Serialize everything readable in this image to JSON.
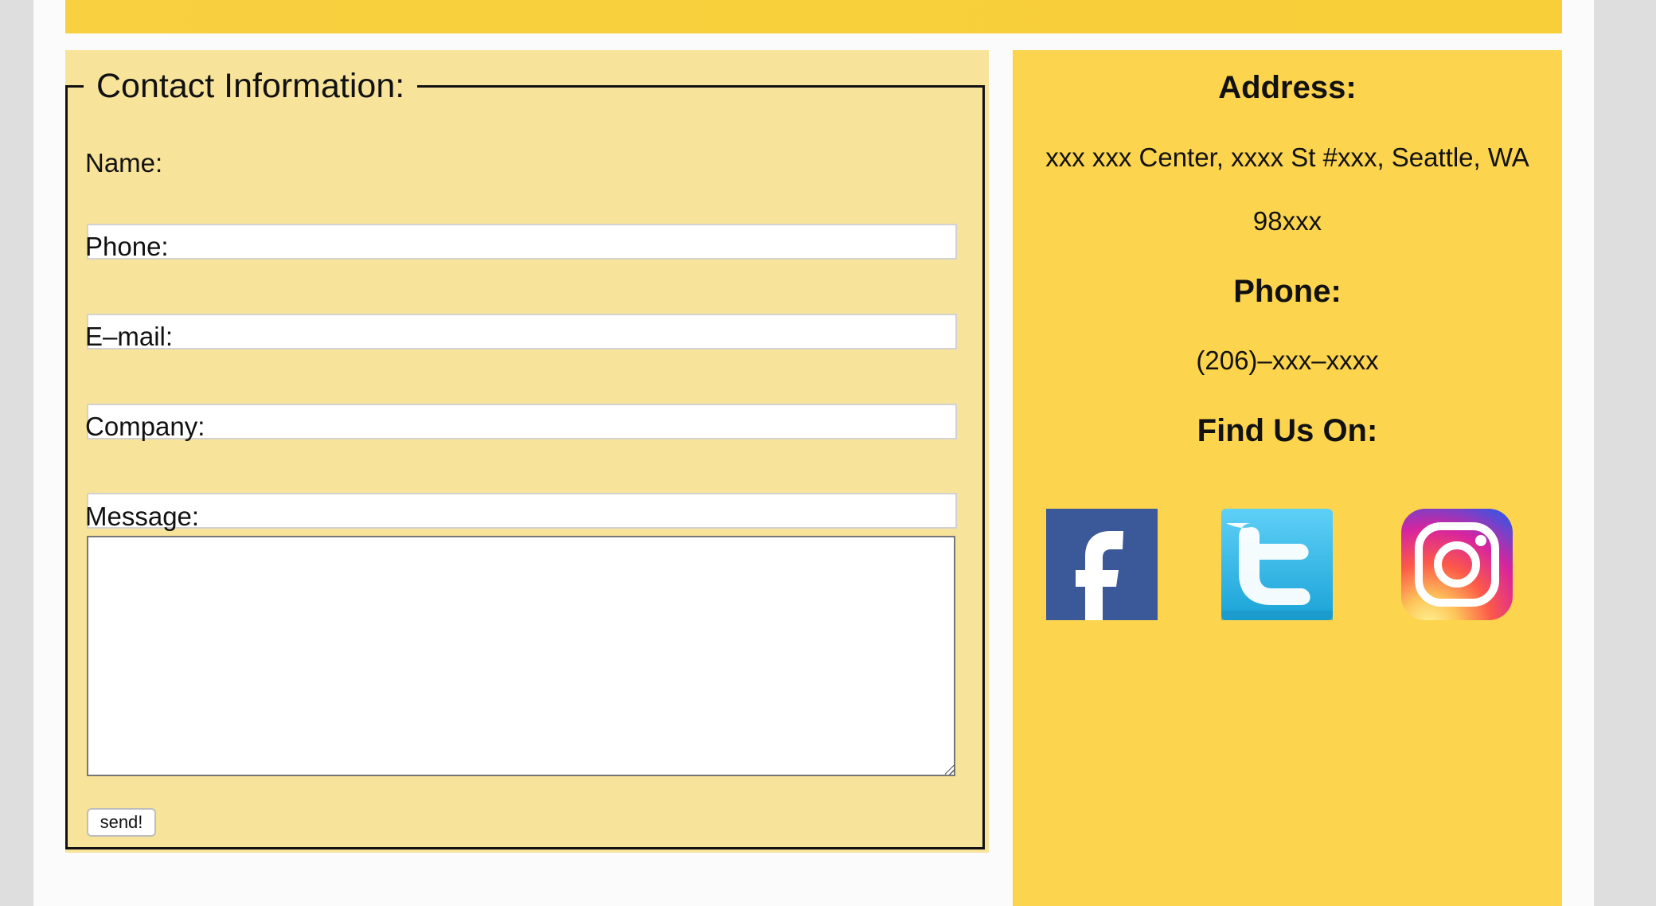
{
  "contact_form": {
    "legend": "Contact Information:",
    "fields": [
      {
        "label": "Name:",
        "value": ""
      },
      {
        "label": "Phone:",
        "value": ""
      },
      {
        "label": "E–mail:",
        "value": ""
      },
      {
        "label": "Company:",
        "value": ""
      }
    ],
    "message": {
      "label": "Message:",
      "value": ""
    },
    "submit_label": "send!"
  },
  "info": {
    "address_heading": "Address:",
    "address_line1": "xxx xxx Center, xxxx St #xxx, Seattle, WA",
    "address_line2": "98xxx",
    "phone_heading": "Phone:",
    "phone_value": "(206)–xxx–xxxx",
    "social_heading": "Find Us On:",
    "social_links": [
      {
        "name": "facebook-icon"
      },
      {
        "name": "twitter-icon"
      },
      {
        "name": "instagram-icon"
      }
    ]
  },
  "colors": {
    "top_bar": "#f8d040",
    "form_panel": "#f8e39a",
    "info_panel": "#fcd44d",
    "facebook": "#3b5998",
    "twitter": "#33b5e5",
    "instagram": [
      "#f9ce34",
      "#ee2a7b",
      "#6228d7"
    ]
  }
}
